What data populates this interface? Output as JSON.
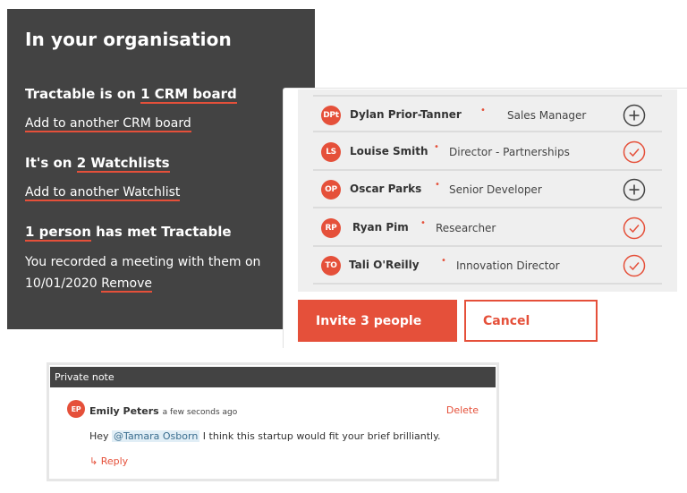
{
  "organisation": {
    "title": "In your organisation",
    "crm": {
      "prefix": "Tractable is on ",
      "link": "1 CRM board",
      "add_link": "Add to another CRM board"
    },
    "watchlists": {
      "prefix": "It's on ",
      "link": "2 Watchlists",
      "add_link": "Add to another Watchlist"
    },
    "meetings": {
      "link": "1 person",
      "suffix": " has met Tractable",
      "text": "You recorded a meeting with them on 10/01/2020 ",
      "remove_link": "Remove"
    }
  },
  "people": [
    {
      "initials": "DPt",
      "name": "Dylan Prior-Tanner",
      "role": "Sales Manager",
      "status": "add"
    },
    {
      "initials": "LS",
      "name": "Louise Smith",
      "role": "Director - Partnerships",
      "status": "selected"
    },
    {
      "initials": "OP",
      "name": "Oscar Parks",
      "role": "Senior Developer",
      "status": "add"
    },
    {
      "initials": "RP",
      "name": "Ryan Pim",
      "role": "Researcher",
      "status": "selected"
    },
    {
      "initials": "TO",
      "name": "Tali O'Reilly",
      "role": "Innovation Director",
      "status": "selected"
    }
  ],
  "buttons": {
    "invite": "Invite 3 people",
    "cancel": "Cancel"
  },
  "note": {
    "header": "Private note",
    "initials": "EP",
    "author": "Emily Peters",
    "time": "a few seconds ago",
    "delete": "Delete",
    "body_prefix": "Hey ",
    "mention": "@Tamara Osborn",
    "body_suffix": " I think this startup would fit your brief brilliantly.",
    "reply": "↳ Reply"
  },
  "colors": {
    "accent": "#e5503a",
    "dark_panel": "#434343",
    "list_bg": "#efefef"
  }
}
